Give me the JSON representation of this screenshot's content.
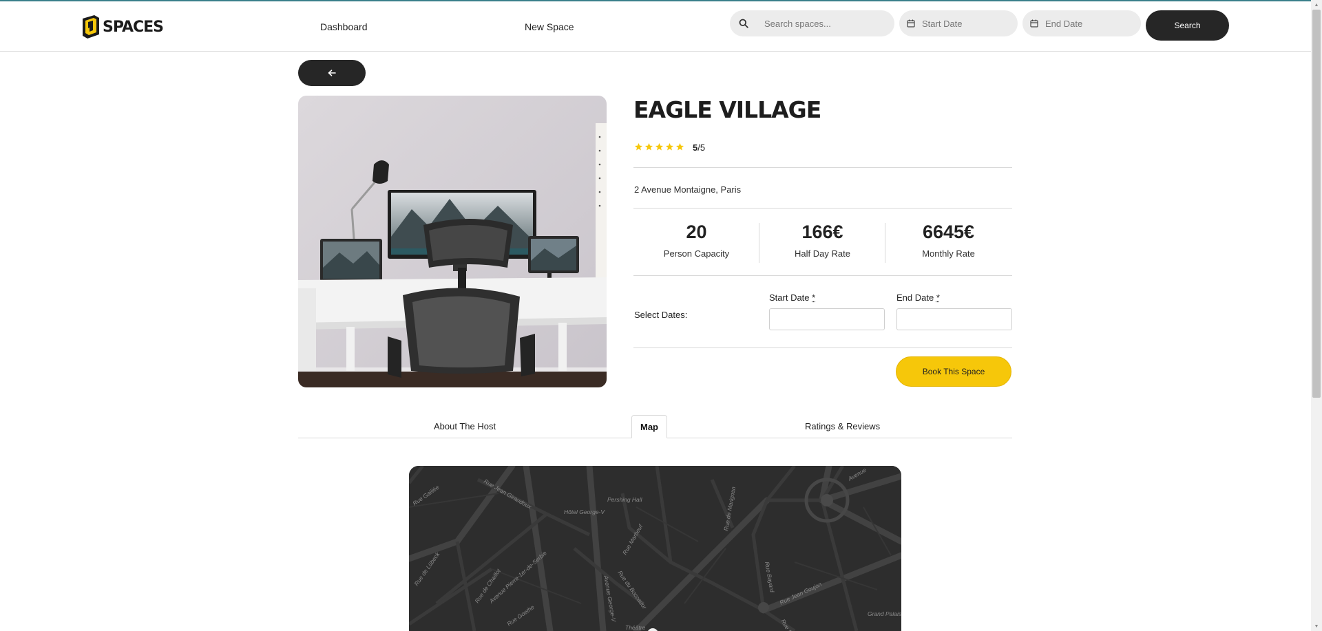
{
  "brand": {
    "name": "SPACES"
  },
  "nav": {
    "dashboard": "Dashboard",
    "new_space": "New Space"
  },
  "search": {
    "placeholder": "Search spaces...",
    "start_placeholder": "Start Date",
    "end_placeholder": "End Date",
    "button": "Search"
  },
  "colors": {
    "accent": "#f6c70a",
    "dark": "#262626",
    "star": "#f6c70a"
  },
  "space": {
    "title": "EAGLE VILLAGE",
    "rating_value": "5",
    "rating_max": "/5",
    "rating_stars": 5,
    "address": "2 Avenue Montaigne, Paris",
    "stats": [
      {
        "value": "20",
        "label": "Person Capacity"
      },
      {
        "value": "166€",
        "label": "Half Day Rate"
      },
      {
        "value": "6645€",
        "label": "Monthly Rate"
      }
    ]
  },
  "booking": {
    "select_label": "Select Dates:",
    "start_label": "Start Date",
    "end_label": "End Date",
    "required_mark": "*",
    "button": "Book This Space"
  },
  "tabs": [
    {
      "label": "About The Host",
      "active": false
    },
    {
      "label": "Map",
      "active": true
    },
    {
      "label": "Ratings & Reviews",
      "active": false
    }
  ],
  "map": {
    "labels": [
      "Rue Galilée",
      "Rue Jean Giraudoux",
      "Hôtel George-V",
      "Pershing Hall",
      "Rue de Marignan",
      "Avenue",
      "Rue de Lübeck",
      "Rue de Chaillot",
      "Avenue Pierre-1er-de-Serbie",
      "Rue Marbeuf",
      "Rue du Boccador",
      "Avenue George-V",
      "Rue Goethe",
      "Rue Bayard",
      "Rue Jean Goujon",
      "Grand Palais",
      "Théâtre",
      "Rue François"
    ]
  },
  "icons": {
    "back": "arrow-left-icon",
    "search": "search-icon",
    "calendar": "calendar-icon",
    "star": "star-icon"
  }
}
